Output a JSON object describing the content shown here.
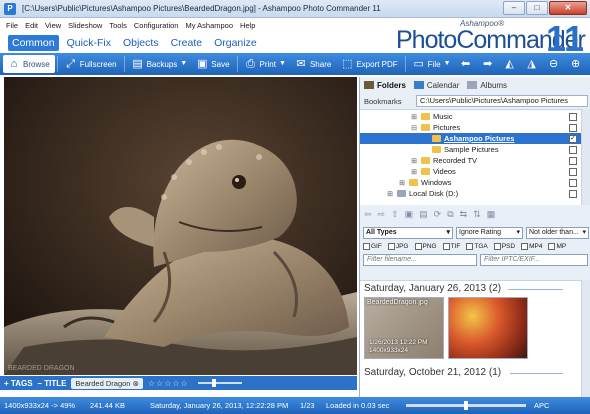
{
  "window": {
    "title": "[C:\\Users\\Public\\Pictures\\Ashampoo Pictures\\BeardedDragon.jpg] - Ashampoo Photo Commander 11",
    "minimize": "–",
    "maximize": "□",
    "close": "✕"
  },
  "menu": [
    "File",
    "Edit",
    "View",
    "Slideshow",
    "Tools",
    "Configuration",
    "My Ashampoo",
    "Help"
  ],
  "logo": {
    "small": "Ashampoo®",
    "big": "PhotoCommander",
    "num": "11"
  },
  "tabs": [
    {
      "label": "Common",
      "active": true
    },
    {
      "label": "Quick-Fix",
      "active": false
    },
    {
      "label": "Objects",
      "active": false
    },
    {
      "label": "Create",
      "active": false
    },
    {
      "label": "Organize",
      "active": false
    }
  ],
  "toolbar": {
    "browse": "Browse",
    "fullscreen": "Fullscreen",
    "backups": "Backups",
    "save": "Save",
    "print": "Print",
    "share": "Share",
    "export_pdf": "Export PDF",
    "file": "File"
  },
  "viewer": {
    "watermark": "BEARDED DRAGON"
  },
  "tagbar": {
    "tags": "+ TAGS",
    "title": "– TITLE",
    "filename": "Bearded Dragon",
    "filename_close": "⊗",
    "stars": "☆☆☆☆☆"
  },
  "status": {
    "dimensions": "1400x933x24 -> 49%",
    "filesize": "241.44 KB",
    "date": "Saturday, January 26, 2013, 12:22:28 PM",
    "position": "1/23",
    "loaded": "Loaded in 0.03 sec",
    "apc": "APC"
  },
  "panel": {
    "tabs": [
      {
        "label": "Folders",
        "active": true,
        "color": "#6a5a3a"
      },
      {
        "label": "Calendar",
        "active": false,
        "color": "#3a7dc8"
      },
      {
        "label": "Albums",
        "active": false,
        "color": "#9aa5b8"
      }
    ],
    "bookmarks_label": "Bookmarks",
    "bookmarks_path": "C:\\Users\\Public\\Pictures\\Ashampoo Pictures",
    "tree": [
      {
        "label": "Music",
        "expander": "⊞",
        "checked": false,
        "selected": false
      },
      {
        "label": "Pictures",
        "expander": "⊟",
        "checked": false,
        "selected": false
      },
      {
        "label": "Ashampoo Pictures",
        "expander": "",
        "checked": true,
        "selected": true
      },
      {
        "label": "Sample Pictures",
        "expander": "",
        "checked": false,
        "selected": false
      },
      {
        "label": "Recorded TV",
        "expander": "⊞",
        "checked": false,
        "selected": false
      },
      {
        "label": "Videos",
        "expander": "⊞",
        "checked": false,
        "selected": false
      },
      {
        "label": "Windows",
        "expander": "⊞",
        "checked": false,
        "selected": false
      },
      {
        "label": "Local Disk (D:)",
        "expander": "⊞",
        "checked": false,
        "selected": false
      }
    ],
    "filter_type": "All Types",
    "filter_rating": "Ignore Rating",
    "filter_age": "Not older than...",
    "file_types": [
      "GIF",
      "JPG",
      "PNG",
      "TIF",
      "TGA",
      "PSD",
      "MP4",
      "MP"
    ],
    "filter_filename_placeholder": "Filter filename...",
    "filter_iptc_placeholder": "Filter IPTC/EXIF...",
    "groups": [
      {
        "date": "Saturday, January 26, 2013 (2)"
      },
      {
        "date": "Saturday, October 21, 2012 (1)"
      }
    ],
    "thumb1": {
      "caption": "BeardedDragon.jpg",
      "date": "1/26/2013 12:22 PM",
      "dims": "1400x933x24"
    }
  }
}
